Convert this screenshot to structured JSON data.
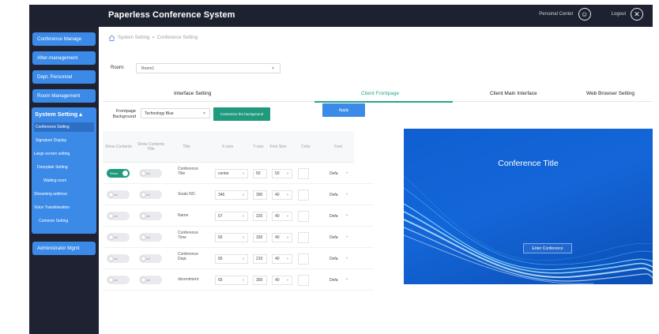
{
  "header": {
    "title": "Paperless Conference System",
    "personal_center": "Personal Center",
    "logout": "Logout",
    "personal_icon": "user-circle-icon",
    "logout_icon": "close-circle-icon"
  },
  "sidebar": {
    "items": [
      {
        "label": "Conference Manage"
      },
      {
        "label": "After-management"
      },
      {
        "label": "Dept. Personnel"
      },
      {
        "label": "Room Management"
      }
    ],
    "system_setting": {
      "label": "System Setting",
      "sub_items": [
        {
          "label": "Conference Setting"
        },
        {
          "label": "Signature Display"
        },
        {
          "label": "Large screen setting"
        },
        {
          "label": "Doorplate Setting"
        },
        {
          "label": "Waiting room"
        },
        {
          "label": "Streaming address"
        },
        {
          "label": "Voice Transliteration"
        },
        {
          "label": "Common Setting"
        }
      ]
    },
    "admin": {
      "label": "Administrator Mgmt"
    }
  },
  "breadcrumb": {
    "parent": "System Setting",
    "separator": "»",
    "current": "Conference Setting"
  },
  "room": {
    "label": "Room:",
    "value": "Room1"
  },
  "tabs": [
    {
      "label": "Interface Setting"
    },
    {
      "label": "Client Frontpage"
    },
    {
      "label": "Client Main Interface"
    },
    {
      "label": "Web Browser Setting"
    }
  ],
  "controls": {
    "fp_label_line1": "Frontpage",
    "fp_label_line2": "Background",
    "fp_value": "Technology Blue",
    "custom_button": "Customize the background",
    "apply_button": "Apply"
  },
  "table": {
    "headers": [
      "Show Contents",
      "Show Contents Title",
      "Title",
      "X-axis",
      "Y-axis",
      "Font Size",
      "Color",
      "Font"
    ],
    "rows": [
      {
        "toggle1": "Show",
        "toggle1_on": true,
        "toggle2": "Hide",
        "title": "Conference Title",
        "x": "center",
        "y": "50",
        "size": "50",
        "font": "Defa"
      },
      {
        "toggle1": "Hide",
        "toggle1_on": false,
        "toggle2": "Hide",
        "title": "Seats NO.",
        "x": "346",
        "y": "390",
        "size": "40",
        "font": "Defa"
      },
      {
        "toggle1": "Hide",
        "toggle1_on": false,
        "toggle2": "Hide",
        "title": "Name",
        "x": "67",
        "y": "220",
        "size": "40",
        "font": "Defa"
      },
      {
        "toggle1": "Hide",
        "toggle1_on": false,
        "toggle2": "Hide",
        "title": "Conference Time",
        "x": "65",
        "y": "330",
        "size": "40",
        "font": "Defa"
      },
      {
        "toggle1": "Hide",
        "toggle1_on": false,
        "toggle2": "Hide",
        "title": "Conference Dept.",
        "x": "65",
        "y": "210",
        "size": "40",
        "font": "Defa"
      },
      {
        "toggle1": "Hide",
        "toggle1_on": false,
        "toggle2": "Hide",
        "title": "docentment",
        "x": "65",
        "y": "300",
        "size": "40",
        "font": "Defa"
      }
    ]
  },
  "preview": {
    "title": "Conference Title",
    "enter_button": "Enter Conference",
    "bg_color": "#1466d8"
  },
  "colors": {
    "accent_blue": "#3b8ae8",
    "accent_green": "#1f9a7c",
    "topbar": "#1e2130"
  }
}
